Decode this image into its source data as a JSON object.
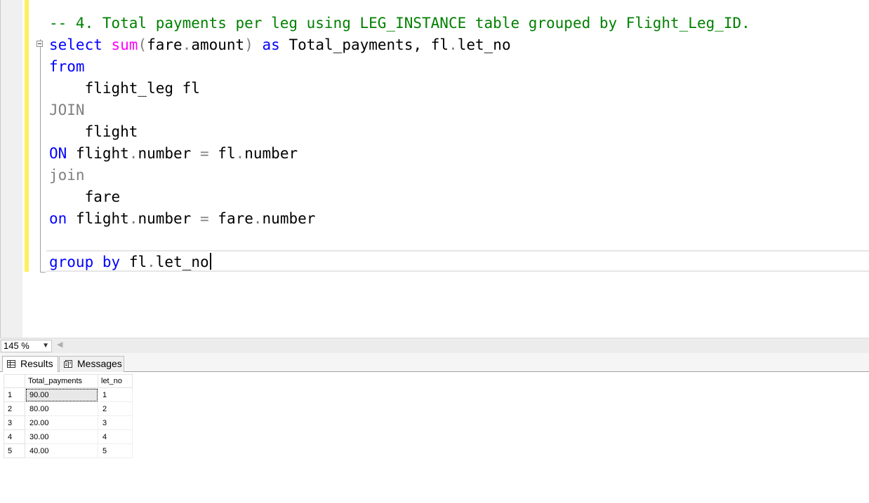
{
  "editor": {
    "lines": {
      "comment": "-- 4. Total payments per leg using LEG_INSTANCE table grouped by Flight_Leg_ID.",
      "select_kw": "select",
      "sum_fn": "sum",
      "paren_open": "(",
      "fare_ref": "fare",
      "amount_col": "amount",
      "paren_close": ")",
      "as_kw": "as",
      "total_alias": "Total_payments,",
      "fl_ref": "fl",
      "let_no_col": "let_no",
      "from_kw": "from",
      "flight_leg_tbl": "flight_leg fl",
      "join_upper": "JOIN",
      "flight_tbl": "flight",
      "on_upper": "ON",
      "flight_ref": "flight",
      "number_col": "number",
      "equals": "=",
      "join_lower": "join",
      "fare_tbl": "fare",
      "on_lower": "on",
      "group_kw": "group",
      "by_kw": "by",
      "dot": "."
    }
  },
  "zoom": {
    "value": "145 %"
  },
  "results_panel": {
    "tabs": [
      {
        "label": "Results",
        "icon": "grid-icon"
      },
      {
        "label": "Messages",
        "icon": "messages-icon"
      }
    ],
    "columns": [
      "Total_payments",
      "let_no"
    ],
    "rows": [
      {
        "num": "1",
        "total": "90.00",
        "let_no": "1"
      },
      {
        "num": "2",
        "total": "80.00",
        "let_no": "2"
      },
      {
        "num": "3",
        "total": "20.00",
        "let_no": "3"
      },
      {
        "num": "4",
        "total": "30.00",
        "let_no": "4"
      },
      {
        "num": "5",
        "total": "40.00",
        "let_no": "5"
      }
    ]
  },
  "colors": {
    "keyword": "#0000ff",
    "function": "#ff00ff",
    "comment": "#008000",
    "operator": "#808080",
    "change_bar": "#ffef5c"
  }
}
